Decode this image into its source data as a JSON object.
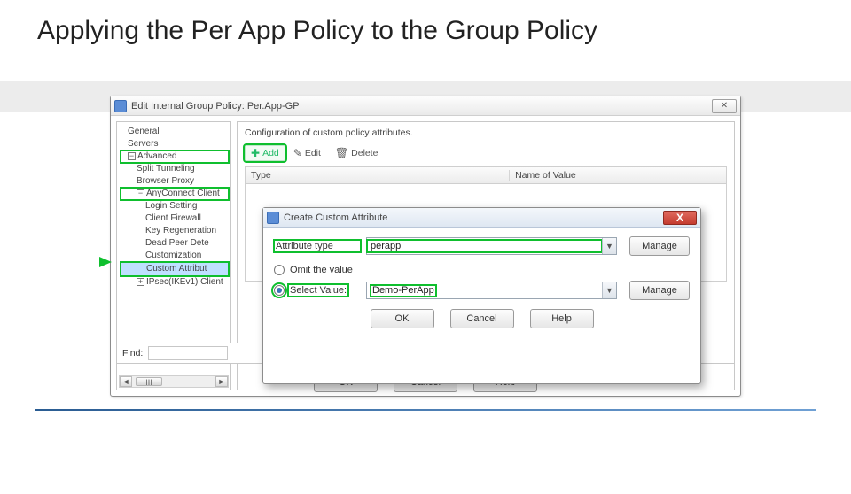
{
  "slide": {
    "title": "Applying the Per App Policy to the Group Policy"
  },
  "parent": {
    "title": "Edit Internal Group Policy: Per.App-GP",
    "desc": "Configuration of custom policy attributes.",
    "toolbar": {
      "add": "Add",
      "edit": "Edit",
      "delete": "Delete"
    },
    "columns": {
      "type": "Type",
      "name": "Name of Value"
    },
    "find_label": "Find:",
    "buttons": {
      "ok": "OK",
      "cancel": "Cancel",
      "help": "Help"
    }
  },
  "tree": {
    "general": "General",
    "servers": "Servers",
    "advanced": "Advanced",
    "split_tunneling": "Split Tunneling",
    "browser_proxy": "Browser Proxy",
    "anyconnect": "AnyConnect Client",
    "login_setting": "Login Setting",
    "client_firewall": "Client Firewall",
    "key_regen": "Key Regeneration",
    "dead_peer": "Dead Peer Dete",
    "customization": "Customization",
    "custom_attr": "Custom Attribut",
    "ipsec": "IPsec(IKEv1) Client",
    "thumb": "III"
  },
  "child": {
    "title": "Create Custom Attribute",
    "attr_type_label": "Attribute type",
    "attr_type_value": "perapp",
    "omit_label": "Omit the value",
    "select_label": "Select Value:",
    "select_value": "Demo-PerApp",
    "manage": "Manage",
    "buttons": {
      "ok": "OK",
      "cancel": "Cancel",
      "help": "Help"
    }
  }
}
